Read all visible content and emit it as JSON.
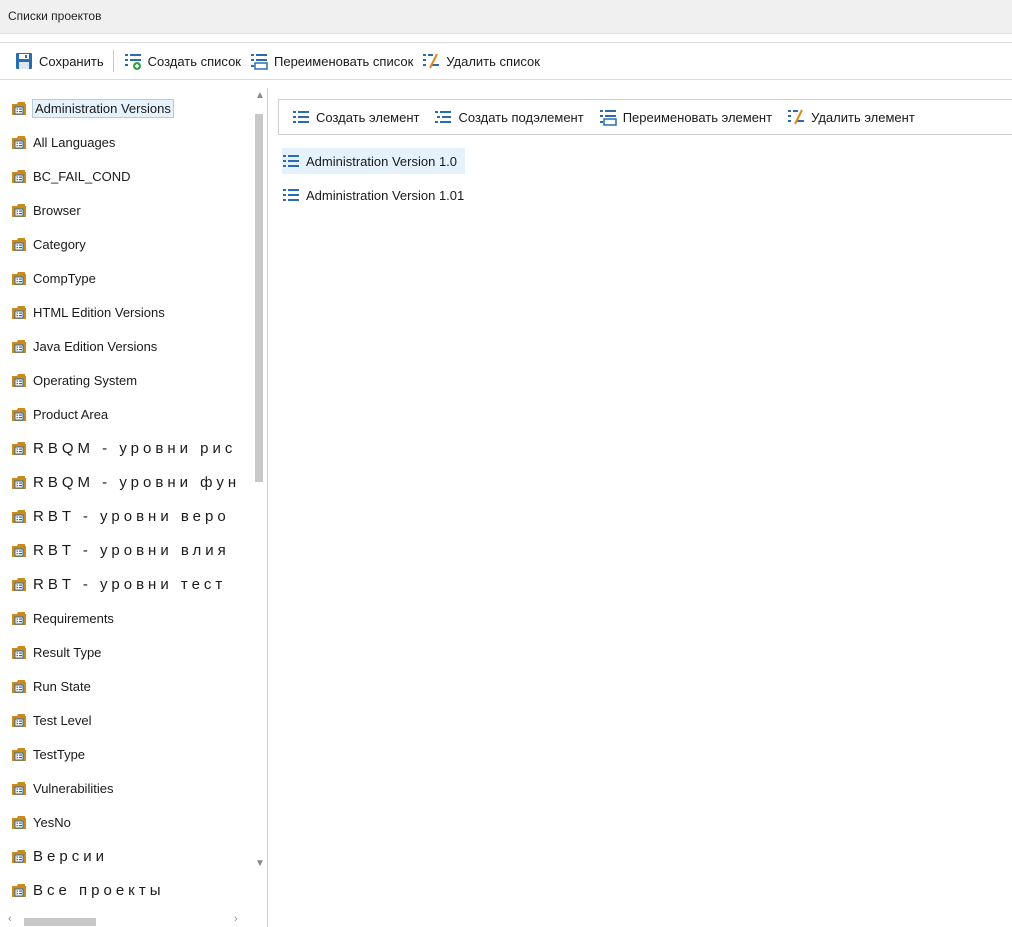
{
  "window": {
    "title": "Списки проектов"
  },
  "toolbar": {
    "save_label": "Сохранить",
    "create_list_label": "Создать список",
    "rename_list_label": "Переименовать список",
    "delete_list_label": "Удалить список"
  },
  "lists": [
    {
      "label": "Administration Versions",
      "selected": true
    },
    {
      "label": "All Languages"
    },
    {
      "label": "BC_FAIL_COND"
    },
    {
      "label": "Browser"
    },
    {
      "label": "Category"
    },
    {
      "label": "CompType"
    },
    {
      "label": "HTML Edition Versions"
    },
    {
      "label": "Java Edition Versions"
    },
    {
      "label": "Operating System"
    },
    {
      "label": "Product Area"
    },
    {
      "label": "RBQM - уровни рис"
    },
    {
      "label": "RBQM - уровни фун"
    },
    {
      "label": "RBT - уровни веро"
    },
    {
      "label": "RBT - уровни влия"
    },
    {
      "label": "RBT - уровни тест"
    },
    {
      "label": "Requirements"
    },
    {
      "label": "Result Type"
    },
    {
      "label": "Run State"
    },
    {
      "label": "Test Level"
    },
    {
      "label": "TestType"
    },
    {
      "label": "Vulnerabilities"
    },
    {
      "label": "YesNo"
    },
    {
      "label": "Версии"
    },
    {
      "label": "Все проекты"
    }
  ],
  "element_toolbar": {
    "create_element_label": "Создать элемент",
    "create_subelement_label": "Создать подэлемент",
    "rename_element_label": "Переименовать элемент",
    "delete_element_label": "Удалить элемент"
  },
  "elements": [
    {
      "label": "Administration Version 1.0",
      "selected": true
    },
    {
      "label": "Administration Version 1.01"
    }
  ],
  "colors": {
    "selection_bg": "#e5f1fb",
    "folder_icon": "#c98a1e",
    "list_icon_blue": "#2b6cb0",
    "add_icon_green": "#3aa34a",
    "delete_icon_orange": "#e08a1e"
  }
}
